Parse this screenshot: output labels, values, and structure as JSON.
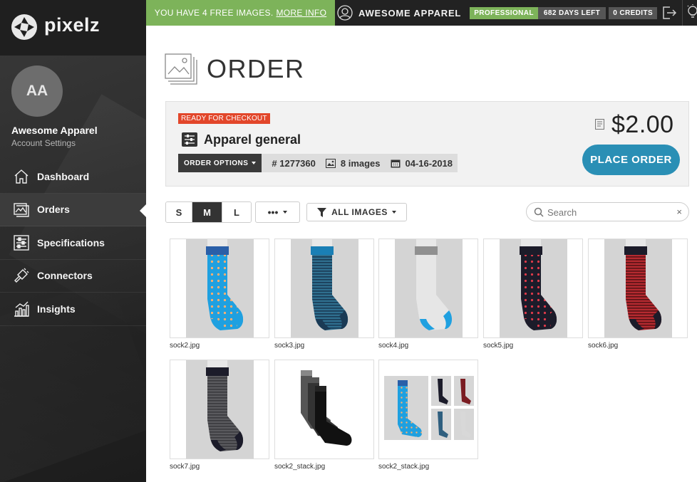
{
  "brand": {
    "name": "pixelz"
  },
  "account": {
    "initials": "AA",
    "name": "Awesome Apparel",
    "settings_label": "Account Settings"
  },
  "nav": {
    "items": [
      {
        "label": "Dashboard",
        "icon": "home-icon"
      },
      {
        "label": "Orders",
        "icon": "images-icon",
        "active": true
      },
      {
        "label": "Specifications",
        "icon": "sliders-icon"
      },
      {
        "label": "Connectors",
        "icon": "plug-icon"
      },
      {
        "label": "Insights",
        "icon": "chart-icon"
      }
    ]
  },
  "topbar": {
    "promo_text": "YOU HAVE 4 FREE IMAGES.",
    "promo_link": "MORE INFO",
    "account_title": "AWESOME APPAREL",
    "plan": "PROFESSIONAL",
    "days_left": "682 DAYS LEFT",
    "credits": "0 CREDITS"
  },
  "page": {
    "title": "ORDER"
  },
  "order": {
    "status": "READY FOR CHECKOUT",
    "spec_name": "Apparel general",
    "options_label": "ORDER OPTIONS",
    "number": "# 1277360",
    "image_count": "8 images",
    "date": "04-16-2018",
    "price": "$2.00",
    "place_order_label": "PLACE ORDER"
  },
  "toolbar": {
    "sizes": [
      "S",
      "M",
      "L"
    ],
    "active_size": "M",
    "more_label": "•••",
    "filter_label": "ALL IMAGES",
    "search_placeholder": "Search",
    "clear_label": "×"
  },
  "images": [
    {
      "file": "sock2.jpg",
      "base": "#1fa0e0",
      "pattern": "dots",
      "accent": "#ffb070",
      "cuff": "#2a5fa8",
      "toe": "#1fa0e0"
    },
    {
      "file": "sock3.jpg",
      "base": "#2f6f8f",
      "pattern": "stripes",
      "accent": "#1a3a55",
      "cuff": "#1a7fb5",
      "toe": "#1a3a55"
    },
    {
      "file": "sock4.jpg",
      "base": "#e6e6e6",
      "pattern": "plain",
      "accent": "#cfcfcf",
      "cuff": "#909090",
      "toe": "#1fa0e0"
    },
    {
      "file": "sock5.jpg",
      "base": "#1c1c2a",
      "pattern": "dots",
      "accent": "#e03a4a",
      "cuff": "#1c1c2a",
      "toe": "#1c1c2a"
    },
    {
      "file": "sock6.jpg",
      "base": "#b52a30",
      "pattern": "stripes",
      "accent": "#5a1216",
      "cuff": "#1c1c2a",
      "toe": "#1c1c2a"
    },
    {
      "file": "sock7.jpg",
      "base": "#5a5a5e",
      "pattern": "stripes",
      "accent": "#3a3a3e",
      "cuff": "#1c1c2a",
      "toe": "#1c1c2a"
    },
    {
      "file": "sock2_stack.jpg",
      "base": "#111111",
      "pattern": "stack",
      "accent": "#777777",
      "cuff": "#444444",
      "toe": "#111111"
    },
    {
      "file": "sock2_stack.jpg",
      "base": "#1fa0e0",
      "pattern": "collage",
      "accent": "#1c1c2a",
      "cuff": "#2a5fa8",
      "toe": "#1fa0e0"
    }
  ]
}
